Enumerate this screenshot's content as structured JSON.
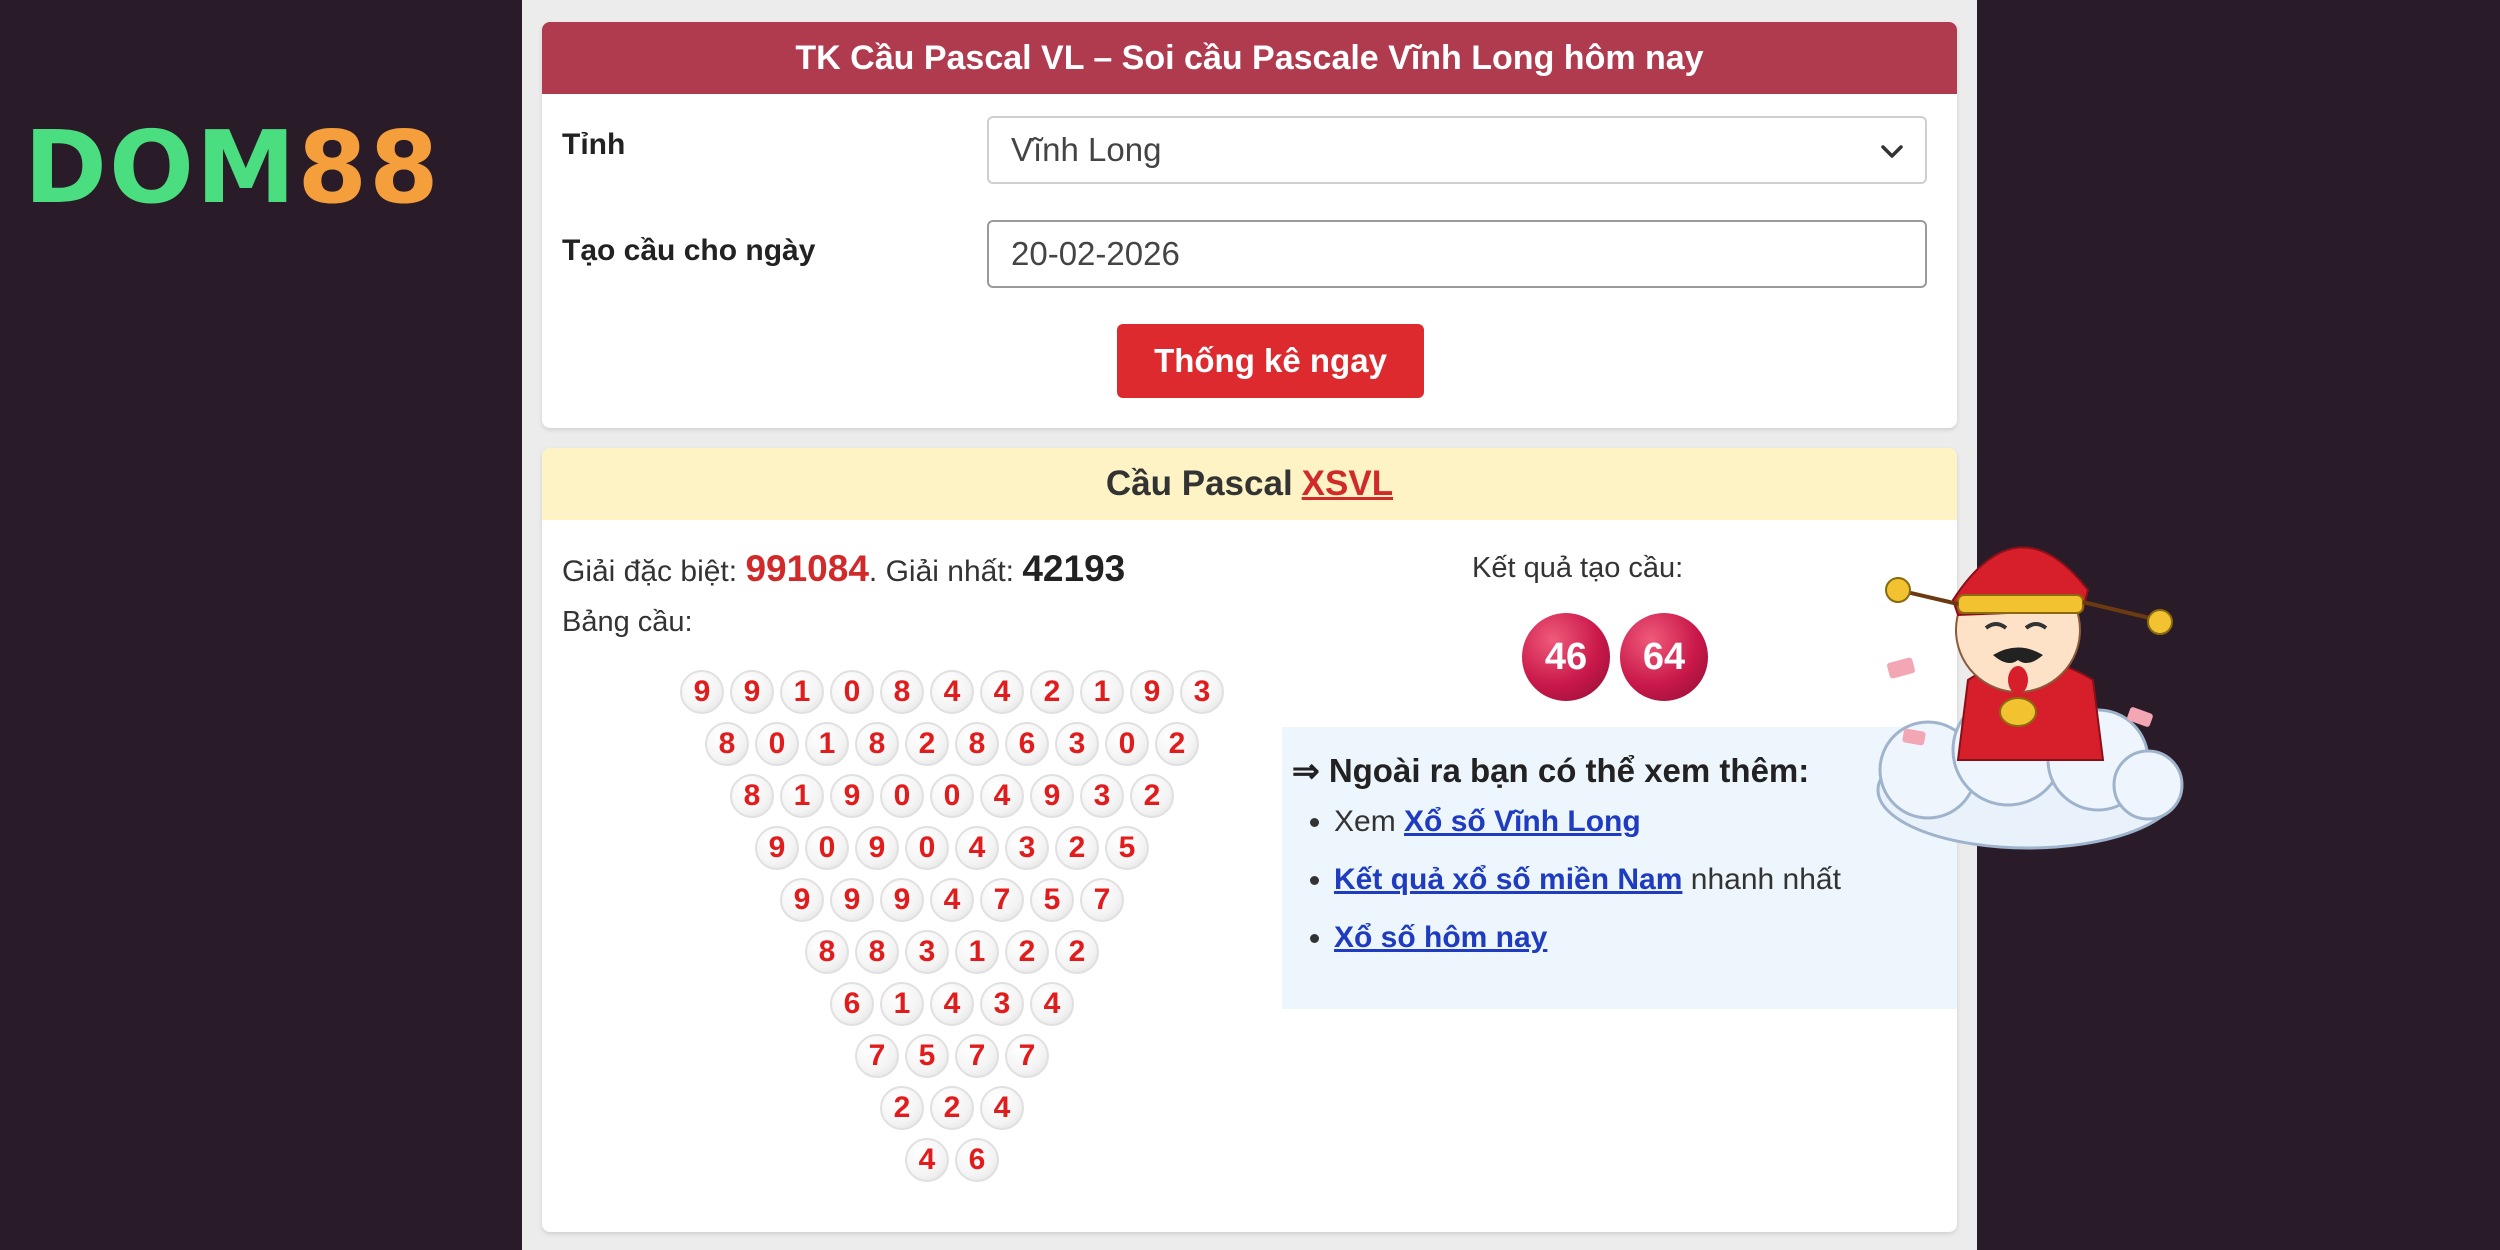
{
  "brand": {
    "logo_part1": "DOM",
    "logo_part2": "88"
  },
  "form": {
    "title": "TK Cầu Pascal VL – Soi cầu Pascale Vĩnh Long hôm nay",
    "province_label": "Tỉnh",
    "province_value": "Vĩnh Long",
    "date_label": "Tạo cầu cho ngày",
    "date_value": "20-02-2026",
    "submit_label": "Thống kê ngay"
  },
  "result": {
    "heading": "Cầu Pascal",
    "heading_link": "XSVL",
    "special_label": "Giải đặc biệt:",
    "special_value": "991084",
    "sep": ". ",
    "first_label": "Giải nhất:",
    "first_value": "42193",
    "table_label": "Bảng cầu:",
    "pyramid": [
      [
        "9",
        "9",
        "1",
        "0",
        "8",
        "4",
        "4",
        "2",
        "1",
        "9",
        "3"
      ],
      [
        "8",
        "0",
        "1",
        "8",
        "2",
        "8",
        "6",
        "3",
        "0",
        "2"
      ],
      [
        "8",
        "1",
        "9",
        "0",
        "0",
        "4",
        "9",
        "3",
        "2"
      ],
      [
        "9",
        "0",
        "9",
        "0",
        "4",
        "3",
        "2",
        "5"
      ],
      [
        "9",
        "9",
        "9",
        "4",
        "7",
        "5",
        "7"
      ],
      [
        "8",
        "8",
        "3",
        "1",
        "2",
        "2"
      ],
      [
        "6",
        "1",
        "4",
        "3",
        "4"
      ],
      [
        "7",
        "5",
        "7",
        "7"
      ],
      [
        "2",
        "2",
        "4"
      ],
      [
        "4",
        "6"
      ]
    ],
    "result_label": "Kết quả tạo cầu:",
    "result_numbers": [
      "46",
      "64"
    ]
  },
  "more": {
    "title": "⇒ Ngoài ra bạn có thể xem thêm:",
    "item1_prefix": "Xem",
    "item1_link": "Xổ số Vĩnh Long",
    "item2_link": "Kết quả xổ số miền Nam",
    "item2_suffix": "nhanh nhất",
    "item3_link": "Xổ số hôm nay"
  },
  "colors": {
    "accent": "#b03a4e",
    "button": "#dd2a2f",
    "digit": "#e01c1c"
  }
}
